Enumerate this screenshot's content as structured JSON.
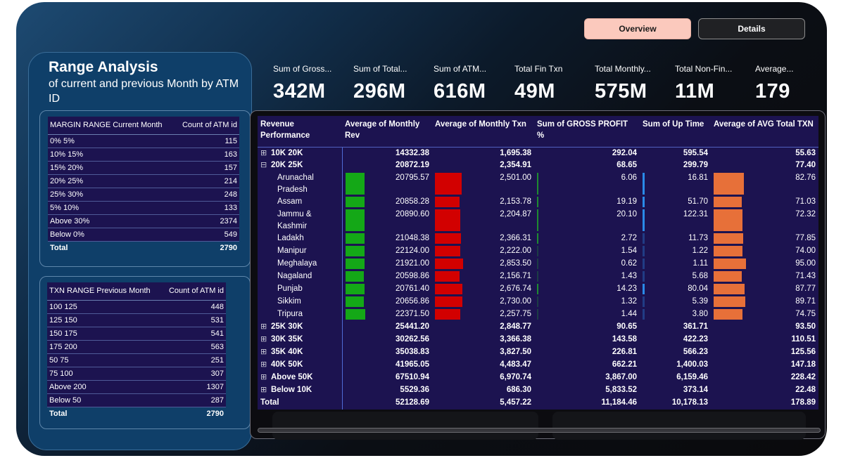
{
  "tabs": {
    "overview": "Overview",
    "details": "Details"
  },
  "left": {
    "title": "Range Analysis",
    "subtitle": "of current and previous Month by ATM ID",
    "margin_table": {
      "headers": [
        "MARGIN RANGE Current Month",
        "Count of ATM id"
      ],
      "rows": [
        [
          "0% 5%",
          "115"
        ],
        [
          "10% 15%",
          "163"
        ],
        [
          "15% 20%",
          "157"
        ],
        [
          "20% 25%",
          "214"
        ],
        [
          "25% 30%",
          "248"
        ],
        [
          "5% 10%",
          "133"
        ],
        [
          "Above 30%",
          "2374"
        ],
        [
          "Below 0%",
          "549"
        ]
      ],
      "total": [
        "Total",
        "2790"
      ]
    },
    "txn_table": {
      "headers": [
        "TXN RANGE Previous Month",
        "Count of ATM id"
      ],
      "rows": [
        [
          "100 125",
          "448"
        ],
        [
          "125 150",
          "531"
        ],
        [
          "150 175",
          "541"
        ],
        [
          "175 200",
          "563"
        ],
        [
          "50 75",
          "251"
        ],
        [
          "75 100",
          "307"
        ],
        [
          "Above 200",
          "1307"
        ],
        [
          "Below 50",
          "287"
        ]
      ],
      "total": [
        "Total",
        "2790"
      ]
    }
  },
  "kpis": [
    {
      "label": "Sum of Gross...",
      "value": "342M"
    },
    {
      "label": "Sum of Total...",
      "value": "296M"
    },
    {
      "label": "Sum of ATM...",
      "value": "616M"
    },
    {
      "label": "Total Fin Txn",
      "value": "49M"
    },
    {
      "label": "Total Monthly...",
      "value": "575M"
    },
    {
      "label": "Total Non-Fin...",
      "value": "11M"
    },
    {
      "label": "Average...",
      "value": "179"
    }
  ],
  "matrix": {
    "headers": [
      "Revenue Performance",
      "Average of Monthly Rev",
      "Average of Monthly Txn",
      "Sum of GROSS PROFIT %",
      "Sum of Up Time",
      "Average of AVG Total TXN"
    ],
    "rows": [
      {
        "type": "group",
        "expander": "⊞",
        "label": "10K 20K",
        "values": [
          "14332.38",
          "1,695.38",
          "292.04",
          "595.54",
          "55.63"
        ]
      },
      {
        "type": "group",
        "expander": "⊟",
        "label": "20K 25K",
        "values": [
          "20872.19",
          "2,354.91",
          "68.65",
          "299.79",
          "77.40"
        ]
      },
      {
        "type": "child",
        "label": "Arunachal Pradesh",
        "values": [
          "20795.57",
          "2,501.00",
          "6.06",
          "16.81",
          "82.76"
        ]
      },
      {
        "type": "child",
        "label": "Assam",
        "values": [
          "20858.28",
          "2,153.78",
          "19.19",
          "51.70",
          "71.03"
        ]
      },
      {
        "type": "child",
        "label": "Jammu & Kashmir",
        "values": [
          "20890.60",
          "2,204.87",
          "20.10",
          "122.31",
          "72.32"
        ]
      },
      {
        "type": "child",
        "label": "Ladakh",
        "values": [
          "21048.38",
          "2,366.31",
          "2.72",
          "11.73",
          "77.85"
        ]
      },
      {
        "type": "child",
        "label": "Manipur",
        "values": [
          "22124.00",
          "2,222.00",
          "1.54",
          "1.22",
          "74.00"
        ]
      },
      {
        "type": "child",
        "label": "Meghalaya",
        "values": [
          "21921.00",
          "2,853.50",
          "0.62",
          "1.11",
          "95.00"
        ]
      },
      {
        "type": "child",
        "label": "Nagaland",
        "values": [
          "20598.86",
          "2,156.71",
          "1.43",
          "5.68",
          "71.43"
        ]
      },
      {
        "type": "child",
        "label": "Punjab",
        "values": [
          "20761.40",
          "2,676.74",
          "14.23",
          "80.04",
          "87.77"
        ]
      },
      {
        "type": "child",
        "label": "Sikkim",
        "values": [
          "20656.86",
          "2,730.00",
          "1.32",
          "5.39",
          "89.71"
        ]
      },
      {
        "type": "child",
        "label": "Tripura",
        "values": [
          "22371.50",
          "2,257.75",
          "1.44",
          "3.80",
          "74.75"
        ]
      },
      {
        "type": "group",
        "expander": "⊞",
        "label": "25K 30K",
        "values": [
          "25441.20",
          "2,848.77",
          "90.65",
          "361.71",
          "93.50"
        ]
      },
      {
        "type": "group",
        "expander": "⊞",
        "label": "30K 35K",
        "values": [
          "30262.56",
          "3,366.38",
          "143.58",
          "422.23",
          "110.51"
        ]
      },
      {
        "type": "group",
        "expander": "⊞",
        "label": "35K 40K",
        "values": [
          "35038.83",
          "3,827.50",
          "226.81",
          "566.23",
          "125.56"
        ]
      },
      {
        "type": "group",
        "expander": "⊞",
        "label": "40K 50K",
        "values": [
          "41965.05",
          "4,483.47",
          "662.21",
          "1,400.03",
          "147.18"
        ]
      },
      {
        "type": "group",
        "expander": "⊞",
        "label": "Above 50K",
        "values": [
          "67510.94",
          "6,970.74",
          "3,867.00",
          "6,159.46",
          "228.42"
        ]
      },
      {
        "type": "group",
        "expander": "⊞",
        "label": "Below 10K",
        "values": [
          "5529.36",
          "686.30",
          "5,833.52",
          "373.14",
          "22.48"
        ]
      },
      {
        "type": "total",
        "label": "Total",
        "values": [
          "52128.69",
          "5,457.22",
          "11,184.46",
          "10,178.13",
          "178.89"
        ]
      }
    ]
  },
  "colors": {
    "bar_rev": "#14a817",
    "bar_txn": "#d20000",
    "bar_avg": "#e77039",
    "bar_profit": "#1e8a30",
    "bar_uptime": "#2a8ae8",
    "header_bg": "#1c1350",
    "accent_tab": "#fbc9bd"
  }
}
